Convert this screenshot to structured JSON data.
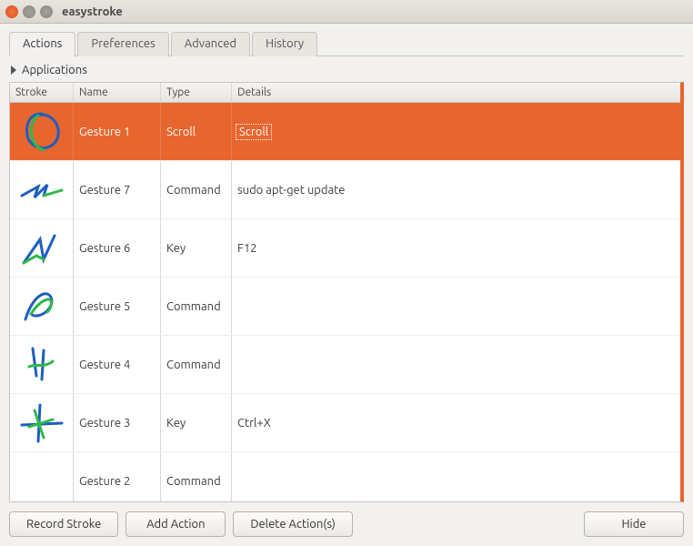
{
  "window": {
    "title": "easystroke"
  },
  "tabs": [
    {
      "label": "Actions",
      "active": true
    },
    {
      "label": "Preferences",
      "active": false
    },
    {
      "label": "Advanced",
      "active": false
    },
    {
      "label": "History",
      "active": false
    }
  ],
  "expander": {
    "label": "Applications"
  },
  "columns": {
    "stroke": "Stroke",
    "name": "Name",
    "type": "Type",
    "details": "Details"
  },
  "rows": [
    {
      "name": "Gesture 1",
      "type": "Scroll",
      "details": "Scroll",
      "selected": true,
      "stroke": "g1"
    },
    {
      "name": "Gesture 7",
      "type": "Command",
      "details": "sudo apt-get update",
      "selected": false,
      "stroke": "g7"
    },
    {
      "name": "Gesture 6",
      "type": "Key",
      "details": "F12",
      "selected": false,
      "stroke": "g6"
    },
    {
      "name": "Gesture 5",
      "type": "Command",
      "details": "",
      "selected": false,
      "stroke": "g5"
    },
    {
      "name": "Gesture 4",
      "type": "Command",
      "details": "",
      "selected": false,
      "stroke": "g4"
    },
    {
      "name": "Gesture 3",
      "type": "Key",
      "details": "Ctrl+X",
      "selected": false,
      "stroke": "g3"
    },
    {
      "name": "Gesture 2",
      "type": "Command",
      "details": "",
      "selected": false,
      "stroke": ""
    }
  ],
  "buttons": {
    "record": "Record Stroke",
    "add": "Add Action",
    "delete": "Delete Action(s)",
    "hide": "Hide"
  },
  "colors": {
    "selection": "#e9652e",
    "stroke_a": "#1d5fbf",
    "stroke_b": "#2fb84b"
  }
}
